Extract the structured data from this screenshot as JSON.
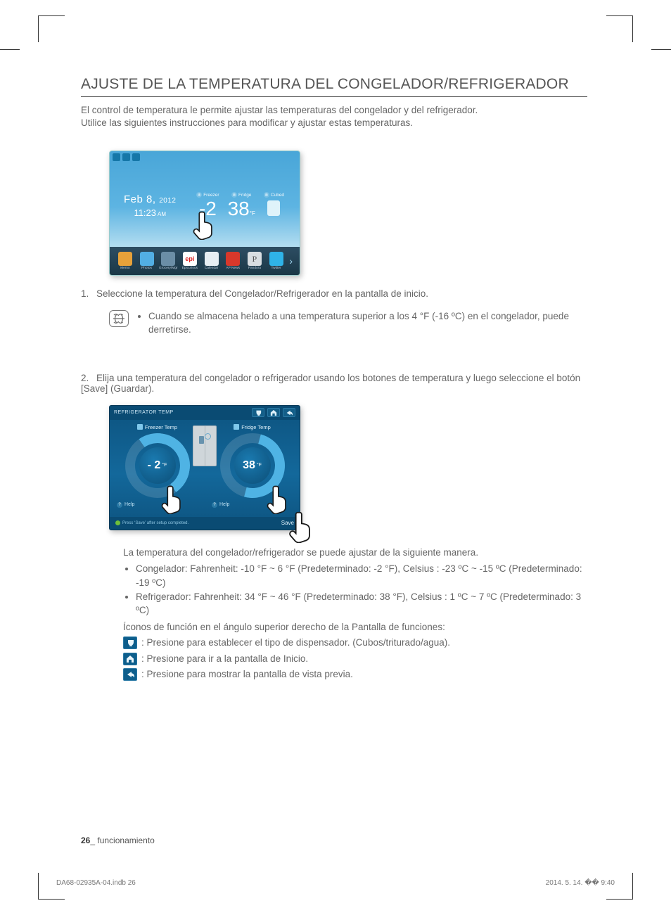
{
  "title": "AJUSTE DE LA TEMPERATURA DEL CONGELADOR/REFRIGERADOR",
  "intro_l1": "El control de temperatura le permite ajustar las temperaturas del congelador y del refrigerador.",
  "intro_l2": "Utilice las siguientes instrucciones para modificar y ajustar estas temperaturas.",
  "home": {
    "date_main": "Feb 8,",
    "date_year": "2012",
    "time": "11:23",
    "time_ampm": "AM",
    "freezer_cap": "Freezer",
    "freezer_val": "-2",
    "fridge_cap": "Fridge",
    "fridge_val": "38",
    "fridge_unit": "°F",
    "cubed_cap": "Cubed",
    "dock": {
      "memo": "Memo",
      "photo": "Photos",
      "gro": "Grocery/Mgr",
      "epi": "Epicurious",
      "epi_short": "epi",
      "cal": "Calendar",
      "ap": "AP News",
      "pan": "Pandora",
      "pan_short": "P",
      "tw": "Twitter"
    }
  },
  "step1": "Seleccione la temperatura del Congelador/Refrigerador en la pantalla de inicio.",
  "note1": "Cuando se almacena helado a una temperatura superior a los 4 °F (-16 ºC) en el congelador, puede derretirse.",
  "step2": "Elija una temperatura del congelador o refrigerador usando los botones de temperatura y luego seleccione el botón [Save] (Guardar).",
  "temp_screen": {
    "title": "REFRIGERATOR TEMP",
    "freezer_sub": "Freezer Temp",
    "fridge_sub": "Fridge Temp",
    "freezer_val": "- 2",
    "freezer_unit": "°F",
    "fridge_val": "38",
    "fridge_unit": "°F",
    "help": "Help",
    "hint": "Press ‘Save’ after setup completed.",
    "save": "Save"
  },
  "explain_intro": "La temperatura del congelador/refrigerador se puede ajustar de la siguiente manera.",
  "bullet_freezer": "Congelador: Fahrenheit: -10 °F ~ 6 °F (Predeterminado: -2 °F), Celsius : -23 ºC ~ -15 ºC (Predeterminado: -19 ºC)",
  "bullet_fridge": "Refrigerador: Fahrenheit: 34 °F ~ 46 °F (Predeterminado: 38 °F), Celsius : 1 ºC ~ 7 ºC (Predeterminado: 3 ºC)",
  "icons_intro": "Íconos de función en el ángulo superior derecho de la Pantalla de funciones:",
  "icon_disp": ": Presione para establecer el tipo de dispensador. (Cubos/triturado/agua).",
  "icon_home": ": Presione para ir a la pantalla de Inicio.",
  "icon_back": ": Presione para mostrar la pantalla de vista previa.",
  "page_no": "26",
  "page_section": "funcionamiento",
  "footer_left": "DA68-02935A-04.indb   26",
  "footer_right": "2014. 5. 14.   �� 9:40"
}
